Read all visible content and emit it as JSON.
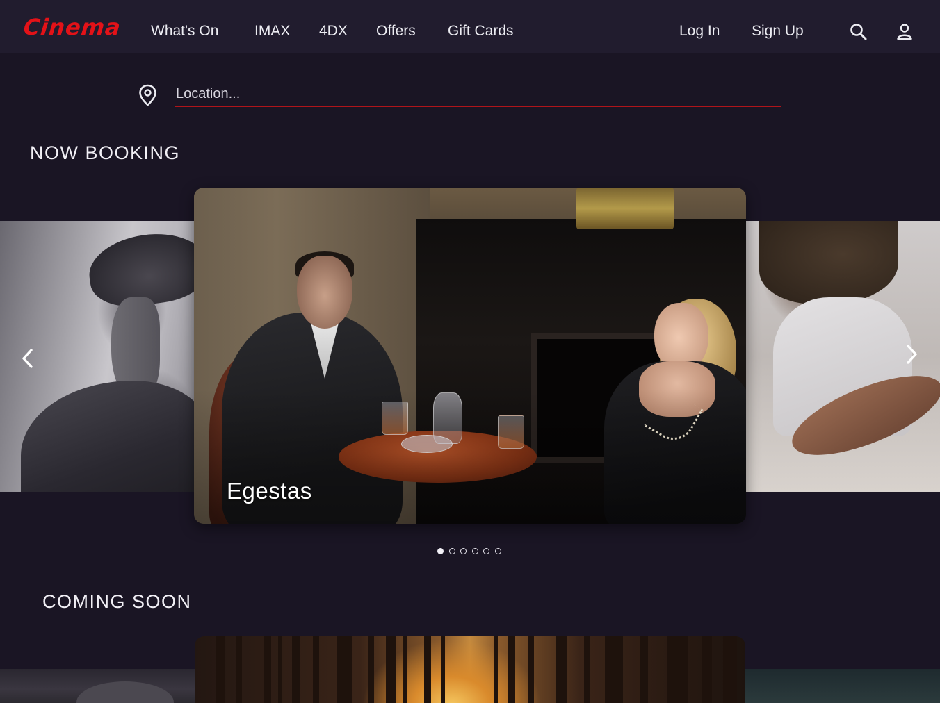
{
  "brand": {
    "logo": "Cinema",
    "color": "#e31218"
  },
  "nav": {
    "links": [
      "What's On",
      "IMAX",
      "4DX",
      "Offers",
      "Gift Cards"
    ],
    "login": "Log In",
    "signup": "Sign Up",
    "icons": [
      "search-icon",
      "user-icon"
    ]
  },
  "location": {
    "placeholder": "Location...",
    "value": "",
    "icon": "map-pin-icon",
    "accent": "#b0141a"
  },
  "now_booking": {
    "title": "NOW BOOKING",
    "current_slide": "Egestas",
    "dots_total": 6,
    "dots_active": 1,
    "prev_icon": "chevron-left-icon",
    "next_icon": "chevron-right-icon"
  },
  "coming_soon": {
    "title": "COMING SOON"
  },
  "theme": {
    "background": "#1a1524",
    "nav_background": "#211c2e"
  }
}
